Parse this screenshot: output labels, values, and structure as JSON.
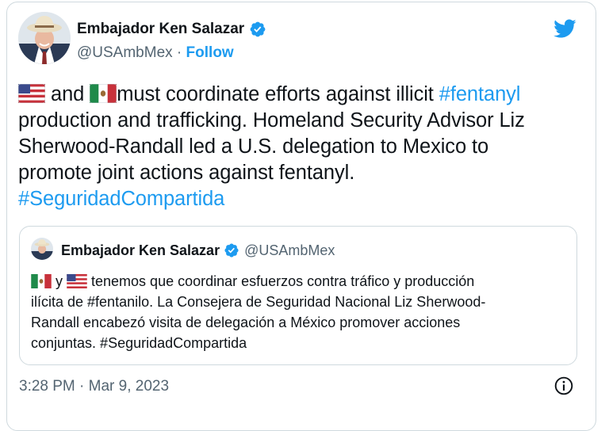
{
  "tweet": {
    "author_name": "Embajador Ken Salazar",
    "handle": "@USAmbMex",
    "separator": " · ",
    "follow_label": "Follow",
    "text": {
      "l1_a": " and ",
      "l1_b": "must coordinate efforts against illicit ",
      "l1_tag": "#fentanyl",
      "l2": "production and trafficking. Homeland Security Advisor Liz",
      "l3": "Sherwood-Randall led a U.S. delegation to Mexico to",
      "l4": "promote joint actions against fentanyl.",
      "l5_tag": "#SeguridadCompartida"
    },
    "timestamp": "3:28 PM · Mar 9, 2023"
  },
  "quote": {
    "author_name": "Embajador Ken Salazar",
    "handle": "@USAmbMex",
    "text": {
      "l1_a": " y ",
      "l1_b": " tenemos que coordinar esfuerzos contra tráfico y producción",
      "l2": "ilícita de #fentanilo. La Consejera de Seguridad Nacional Liz Sherwood-",
      "l3": "Randall encabezó visita de delegación a México promover acciones",
      "l4": "conjuntas. #SeguridadCompartida"
    }
  },
  "icons": {
    "logo": "twitter-bird-icon",
    "verified": "verified-badge-icon",
    "info": "info-icon",
    "flag_us": "us-flag-icon",
    "flag_mx": "mexico-flag-icon"
  },
  "colors": {
    "accent": "#1d9bf0",
    "text": "#0f1419",
    "secondary": "#536471",
    "border": "#cfd9de"
  }
}
